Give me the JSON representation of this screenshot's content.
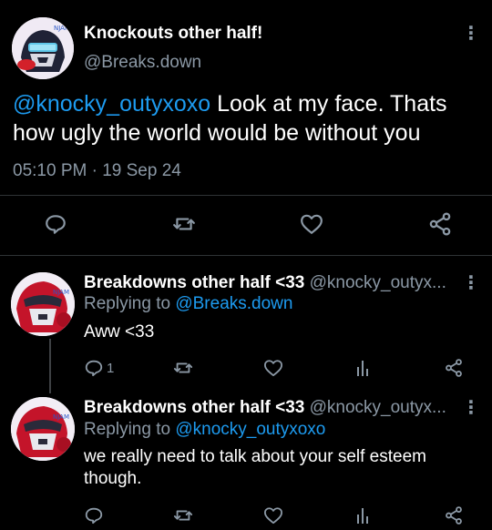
{
  "main_tweet": {
    "display_name": "Knockouts other half!",
    "handle": "@Breaks.down",
    "mention": "@knocky_outyxoxo",
    "text": " Look at my face. Thats how ugly the world would be without you",
    "time": "05:10 PM",
    "separator": "·",
    "date": "19 Sep 24",
    "avatar_label": "NJAM",
    "avatar_badge": "Knife"
  },
  "replies": [
    {
      "display_name": "Breakdowns other half <33",
      "handle": "@knocky_outyx...",
      "replying_prefix": "Replying to ",
      "replying_to": "@Breaks.down",
      "text": "Aww <33",
      "reply_count": "1",
      "avatar_label": "NJAM"
    },
    {
      "display_name": "Breakdowns other half <33",
      "handle": "@knocky_outyx...",
      "replying_prefix": "Replying to ",
      "replying_to": "@knocky_outyxoxo",
      "text": "we really need to talk about your self esteem though.",
      "reply_count": "",
      "avatar_label": "NJAM"
    }
  ],
  "colors": {
    "background": "#000000",
    "text": "#e7e9ea",
    "muted": "#8b98a5",
    "link": "#1d9bf0",
    "divider": "#2f3336"
  },
  "icons": [
    "reply-icon",
    "retweet-icon",
    "like-icon",
    "share-icon",
    "views-icon",
    "more-icon"
  ]
}
